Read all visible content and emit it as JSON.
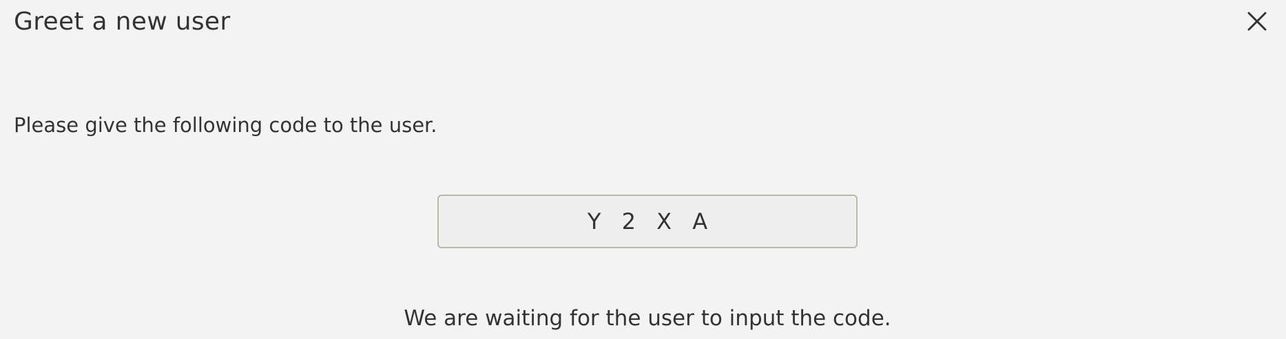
{
  "dialog": {
    "title": "Greet a new user",
    "close_icon": "close-icon",
    "instruction": "Please give the following code to the user.",
    "code": "Y2XA",
    "code_display": "Y 2 X A",
    "waiting_message": "We are waiting for the user to input the code."
  },
  "colors": {
    "background": "#f3f3f3",
    "text": "#333333",
    "code_box_border": "#b8b8ac",
    "code_box_fill": "#eeeeee"
  }
}
